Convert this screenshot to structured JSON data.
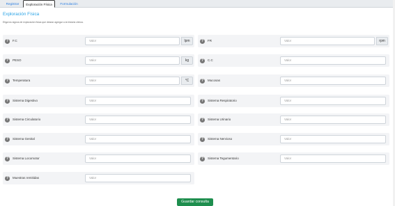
{
  "tabs": [
    {
      "label": "Registrar"
    },
    {
      "label": "Exploración Física"
    },
    {
      "label": "Formulación"
    }
  ],
  "section": {
    "title": "Exploración Física",
    "subtitle": "Eliga los signos de exploración física que desear agregar a la historia clínica."
  },
  "placeholder": "Valor",
  "fields": {
    "fc": {
      "label": "F.C",
      "unit": "lpm"
    },
    "fr": {
      "label": "FR",
      "unit": "rpm"
    },
    "peso": {
      "label": "PESO",
      "unit": "kg"
    },
    "cc": {
      "label": "C.C"
    },
    "temperatura": {
      "label": "Temperatura",
      "unit": "°C"
    },
    "mucosas": {
      "label": "Mucosas"
    },
    "digestivo": {
      "label": "Sistema Digestivo"
    },
    "respiratorio": {
      "label": "Sistema Respiratorio"
    },
    "circulatorio": {
      "label": "Sistema Circulatorio"
    },
    "urinario": {
      "label": "Sistema Urinario"
    },
    "genital": {
      "label": "Sistema Genital"
    },
    "nervioso": {
      "label": "Sistema Nervioso"
    },
    "locomotor": {
      "label": "Sistema Locomotor"
    },
    "tegumentario": {
      "label": "Sistema Tegumentario"
    },
    "muestras": {
      "label": "Muestras remitidas"
    }
  },
  "actions": {
    "save_label": "Guardar consulta"
  },
  "colors": {
    "accent": "#2aa3e6",
    "save": "#1e8e4e",
    "tab_link": "#2a7de1"
  }
}
